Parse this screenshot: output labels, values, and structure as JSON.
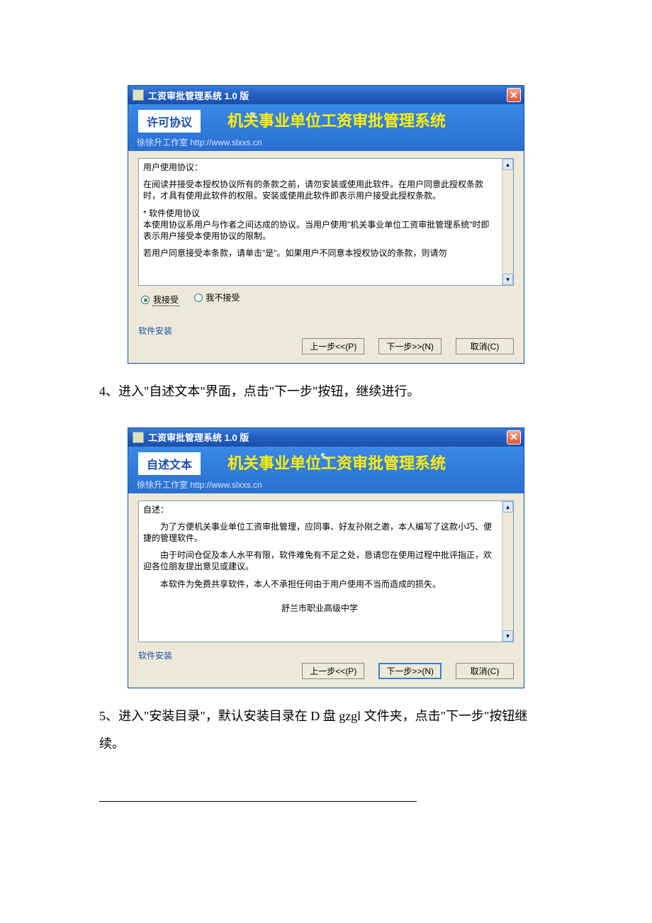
{
  "dialog1": {
    "title": "工资审批管理系统 1.0 版",
    "headerBox": "许可协议",
    "banner": "机关事业单位工资审批管理系统",
    "url": "徐徐升工作室 http://www.slxxs.cn",
    "text": {
      "heading": "用户使用协议：",
      "p1": "在阅读并接受本授权协议所有的条款之前，请勿安装或使用此软件。在用户同意此授权条款时，才具有使用此软件的权限。安装或使用此软件即表示用户接受此授权条款。",
      "p2a": "* 软件使用协议",
      "p2b": "本使用协议系用户与作者之间达成的协议。当用户使用\"机关事业单位工资审批管理系统\"时即表示用户接受本使用协议的限制。",
      "p3": "若用户同意接受本条款，请单击\"是\"。如果用户不同意本授权协议的条款，则请勿"
    },
    "radioAccept": "我接受",
    "radioReject": "我不接受",
    "installLabel": "软件安装",
    "btnPrev": "上一步<<(P)",
    "btnNext": "下一步>>(N)",
    "btnCancel": "取消(C)"
  },
  "docLine4": "4、进入\"自述文本\"界面，点击\"下一步\"按钮，继续进行。",
  "dialog2": {
    "title": "工资审批管理系统 1.0 版",
    "headerBox": "自述文本",
    "banner": "机关事业单位工资审批管理系统",
    "url": "徐徐升工作室 http://www.slxxs.cn",
    "text": {
      "heading": "自述：",
      "p1": "　　为了方便机关事业单位工资审批管理，应同事、好友孙刚之邀，本人编写了这款小巧、便捷的管理软件。",
      "p2": "　　由于时间仓促及本人水平有限，软件难免有不足之处，恳请您在使用过程中批评指正，欢迎各位朋友提出意见或建议。",
      "p3": "　　本软件为免费共享软件，本人不承担任何由于用户使用不当而造成的损失。",
      "sig": "舒兰市职业高级中学"
    },
    "installLabel": "软件安装",
    "btnPrev": "上一步<<(P)",
    "btnNext": "下一步>>(N)",
    "btnCancel": "取消(C)"
  },
  "docLine5": "5、进入\"安装目录\"，默认安装目录在 D 盘 gzgl 文件夹，点击\"下一步\"按钮继续。"
}
